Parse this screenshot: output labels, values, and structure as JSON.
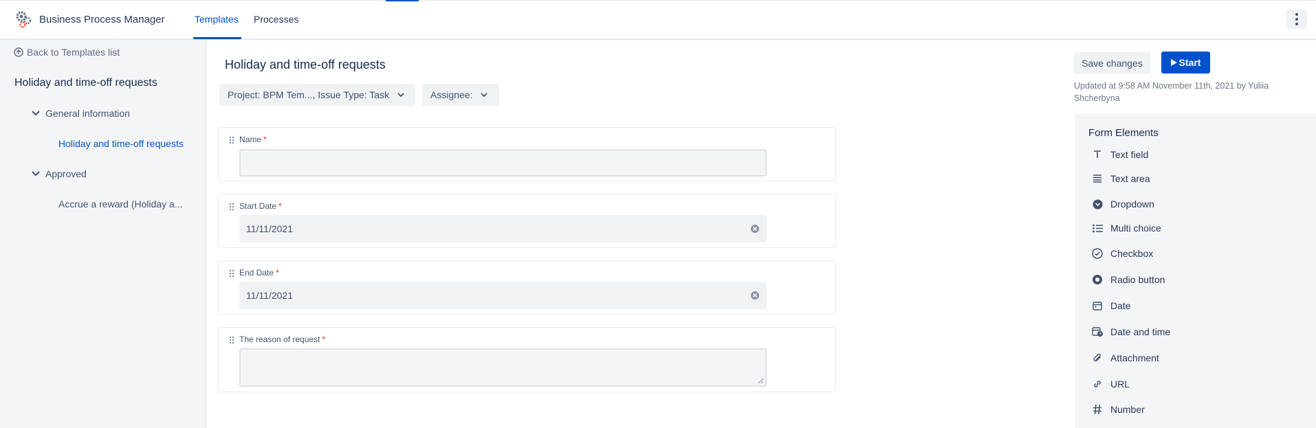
{
  "app": {
    "title": "Business Process Manager"
  },
  "nav": {
    "tabs": [
      {
        "label": "Templates",
        "active": true
      },
      {
        "label": "Processes",
        "active": false
      }
    ]
  },
  "colors": {
    "accent": "#0052cc",
    "required": "#de350b"
  },
  "sidebar": {
    "back_label": "Back to Templates list",
    "title": "Holiday and time-off requests",
    "groups": [
      {
        "label": "General information",
        "items": [
          {
            "label": "Holiday and time-off requests",
            "active": true
          }
        ]
      },
      {
        "label": "Approved",
        "items": [
          {
            "label": "Accrue a reward (Holiday a...",
            "active": false
          }
        ]
      }
    ]
  },
  "main": {
    "title": "Holiday and time-off requests",
    "filters": [
      {
        "label": "Project: BPM Tem..., Issue Type: Task"
      },
      {
        "label": "Assignee:"
      }
    ],
    "save_label": "Save changes",
    "start_label": "Start",
    "updated": "Updated at 9:58 AM November 11th, 2021 by Yuliia Shcherbyna"
  },
  "form": {
    "fields": [
      {
        "label": "Name",
        "required": "*",
        "type": "text",
        "value": ""
      },
      {
        "label": "Start Date",
        "required": "*",
        "type": "date",
        "value": "11/11/2021"
      },
      {
        "label": "End Date",
        "required": "*",
        "type": "date",
        "value": "11/11/2021"
      },
      {
        "label": "The reason of request",
        "required": "*",
        "type": "textarea",
        "value": ""
      }
    ]
  },
  "palette": {
    "title": "Form Elements",
    "items": [
      {
        "label": "Text field",
        "icon": "text-field-icon"
      },
      {
        "label": "Text area",
        "icon": "text-area-icon"
      },
      {
        "label": "Dropdown",
        "icon": "dropdown-icon"
      },
      {
        "label": "Multi choice",
        "icon": "multi-choice-icon"
      },
      {
        "label": "Checkbox",
        "icon": "checkbox-icon"
      },
      {
        "label": "Radio button",
        "icon": "radio-button-icon"
      },
      {
        "label": "Date",
        "icon": "date-icon"
      },
      {
        "label": "Date and time",
        "icon": "date-time-icon"
      },
      {
        "label": "Attachment",
        "icon": "attachment-icon"
      },
      {
        "label": "URL",
        "icon": "link-icon"
      },
      {
        "label": "Number",
        "icon": "number-icon"
      }
    ]
  }
}
